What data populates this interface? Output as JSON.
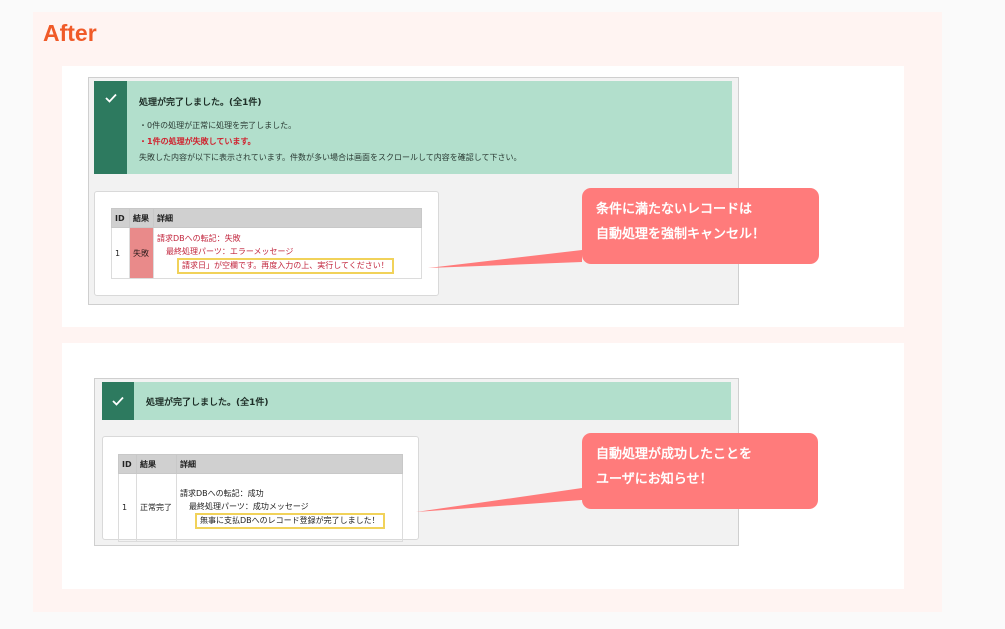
{
  "heading": "After",
  "example1": {
    "notice": {
      "title": "処理が完了しました。(全1件)",
      "lines": [
        "・0件の処理が正常に処理を完了しました。",
        "・1件の処理が失敗しています。",
        "失敗した内容が以下に表示されています。件数が多い場合は画面をスクロールして内容を確認して下さい。"
      ]
    },
    "table": {
      "headers": [
        "ID",
        "結果",
        "詳細"
      ],
      "row": {
        "id": "1",
        "result": "失敗",
        "detail_line1": "請求DBへの転記：失敗",
        "detail_line2": "最終処理パーツ：エラーメッセージ",
        "detail_message": "請求日」が空欄です。再度入力の上、実行してください！"
      }
    },
    "callout": [
      "条件に満たないレコードは",
      "自動処理を強制キャンセル！"
    ]
  },
  "example2": {
    "notice": {
      "title": "処理が完了しました。(全1件)"
    },
    "table": {
      "headers": [
        "ID",
        "結果",
        "詳細"
      ],
      "row": {
        "id": "1",
        "result": "正常完了",
        "detail_line1": "請求DBへの転記：成功",
        "detail_line2": "最終処理パーツ：成功メッセージ",
        "detail_message": "無事に支払DBへのレコード登録が完了しました！"
      }
    },
    "callout": [
      "自動処理が成功したことを",
      "ユーザにお知らせ！"
    ]
  },
  "colors": {
    "heading": "#f05a28",
    "notice_bg": "#b2dfcc",
    "check_bg": "#2d7a5f",
    "error_text": "#d0212d",
    "fail_cell": "#e98a8a",
    "highlight": "#f1d25a",
    "callout": "#ff7b7b"
  },
  "icons": [
    "check-icon"
  ]
}
